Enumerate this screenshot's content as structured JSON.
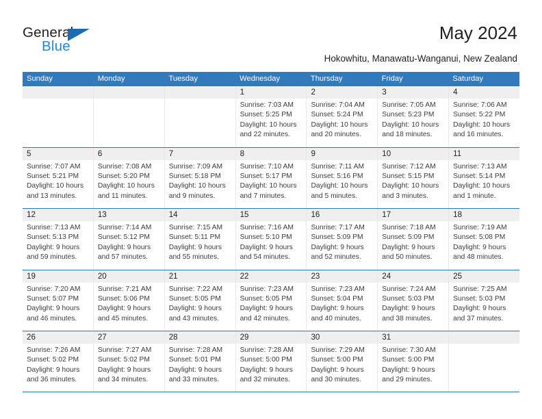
{
  "brand": {
    "name_top": "General",
    "name_bottom": "Blue",
    "triangle_color": "#1b6cb3",
    "blue_text_color": "#2487d4"
  },
  "header": {
    "title": "May 2024",
    "subtitle": "Hokowhitu, Manawatu-Wanganui, New Zealand"
  },
  "theme": {
    "header_row_bg": "#3379bd",
    "row_divider": "#2f76bb",
    "day_number_bg": "#efefef"
  },
  "weekdays": [
    "Sunday",
    "Monday",
    "Tuesday",
    "Wednesday",
    "Thursday",
    "Friday",
    "Saturday"
  ],
  "weeks": [
    [
      {
        "day": "",
        "sunrise": "",
        "sunset": "",
        "daylight": "",
        "empty": true
      },
      {
        "day": "",
        "sunrise": "",
        "sunset": "",
        "daylight": "",
        "empty": true
      },
      {
        "day": "",
        "sunrise": "",
        "sunset": "",
        "daylight": "",
        "empty": true
      },
      {
        "day": "1",
        "sunrise": "Sunrise: 7:03 AM",
        "sunset": "Sunset: 5:25 PM",
        "daylight": "Daylight: 10 hours and 22 minutes."
      },
      {
        "day": "2",
        "sunrise": "Sunrise: 7:04 AM",
        "sunset": "Sunset: 5:24 PM",
        "daylight": "Daylight: 10 hours and 20 minutes."
      },
      {
        "day": "3",
        "sunrise": "Sunrise: 7:05 AM",
        "sunset": "Sunset: 5:23 PM",
        "daylight": "Daylight: 10 hours and 18 minutes."
      },
      {
        "day": "4",
        "sunrise": "Sunrise: 7:06 AM",
        "sunset": "Sunset: 5:22 PM",
        "daylight": "Daylight: 10 hours and 16 minutes."
      }
    ],
    [
      {
        "day": "5",
        "sunrise": "Sunrise: 7:07 AM",
        "sunset": "Sunset: 5:21 PM",
        "daylight": "Daylight: 10 hours and 13 minutes."
      },
      {
        "day": "6",
        "sunrise": "Sunrise: 7:08 AM",
        "sunset": "Sunset: 5:20 PM",
        "daylight": "Daylight: 10 hours and 11 minutes."
      },
      {
        "day": "7",
        "sunrise": "Sunrise: 7:09 AM",
        "sunset": "Sunset: 5:18 PM",
        "daylight": "Daylight: 10 hours and 9 minutes."
      },
      {
        "day": "8",
        "sunrise": "Sunrise: 7:10 AM",
        "sunset": "Sunset: 5:17 PM",
        "daylight": "Daylight: 10 hours and 7 minutes."
      },
      {
        "day": "9",
        "sunrise": "Sunrise: 7:11 AM",
        "sunset": "Sunset: 5:16 PM",
        "daylight": "Daylight: 10 hours and 5 minutes."
      },
      {
        "day": "10",
        "sunrise": "Sunrise: 7:12 AM",
        "sunset": "Sunset: 5:15 PM",
        "daylight": "Daylight: 10 hours and 3 minutes."
      },
      {
        "day": "11",
        "sunrise": "Sunrise: 7:13 AM",
        "sunset": "Sunset: 5:14 PM",
        "daylight": "Daylight: 10 hours and 1 minute."
      }
    ],
    [
      {
        "day": "12",
        "sunrise": "Sunrise: 7:13 AM",
        "sunset": "Sunset: 5:13 PM",
        "daylight": "Daylight: 9 hours and 59 minutes."
      },
      {
        "day": "13",
        "sunrise": "Sunrise: 7:14 AM",
        "sunset": "Sunset: 5:12 PM",
        "daylight": "Daylight: 9 hours and 57 minutes."
      },
      {
        "day": "14",
        "sunrise": "Sunrise: 7:15 AM",
        "sunset": "Sunset: 5:11 PM",
        "daylight": "Daylight: 9 hours and 55 minutes."
      },
      {
        "day": "15",
        "sunrise": "Sunrise: 7:16 AM",
        "sunset": "Sunset: 5:10 PM",
        "daylight": "Daylight: 9 hours and 54 minutes."
      },
      {
        "day": "16",
        "sunrise": "Sunrise: 7:17 AM",
        "sunset": "Sunset: 5:09 PM",
        "daylight": "Daylight: 9 hours and 52 minutes."
      },
      {
        "day": "17",
        "sunrise": "Sunrise: 7:18 AM",
        "sunset": "Sunset: 5:09 PM",
        "daylight": "Daylight: 9 hours and 50 minutes."
      },
      {
        "day": "18",
        "sunrise": "Sunrise: 7:19 AM",
        "sunset": "Sunset: 5:08 PM",
        "daylight": "Daylight: 9 hours and 48 minutes."
      }
    ],
    [
      {
        "day": "19",
        "sunrise": "Sunrise: 7:20 AM",
        "sunset": "Sunset: 5:07 PM",
        "daylight": "Daylight: 9 hours and 46 minutes."
      },
      {
        "day": "20",
        "sunrise": "Sunrise: 7:21 AM",
        "sunset": "Sunset: 5:06 PM",
        "daylight": "Daylight: 9 hours and 45 minutes."
      },
      {
        "day": "21",
        "sunrise": "Sunrise: 7:22 AM",
        "sunset": "Sunset: 5:05 PM",
        "daylight": "Daylight: 9 hours and 43 minutes."
      },
      {
        "day": "22",
        "sunrise": "Sunrise: 7:23 AM",
        "sunset": "Sunset: 5:05 PM",
        "daylight": "Daylight: 9 hours and 42 minutes."
      },
      {
        "day": "23",
        "sunrise": "Sunrise: 7:23 AM",
        "sunset": "Sunset: 5:04 PM",
        "daylight": "Daylight: 9 hours and 40 minutes."
      },
      {
        "day": "24",
        "sunrise": "Sunrise: 7:24 AM",
        "sunset": "Sunset: 5:03 PM",
        "daylight": "Daylight: 9 hours and 38 minutes."
      },
      {
        "day": "25",
        "sunrise": "Sunrise: 7:25 AM",
        "sunset": "Sunset: 5:03 PM",
        "daylight": "Daylight: 9 hours and 37 minutes."
      }
    ],
    [
      {
        "day": "26",
        "sunrise": "Sunrise: 7:26 AM",
        "sunset": "Sunset: 5:02 PM",
        "daylight": "Daylight: 9 hours and 36 minutes."
      },
      {
        "day": "27",
        "sunrise": "Sunrise: 7:27 AM",
        "sunset": "Sunset: 5:02 PM",
        "daylight": "Daylight: 9 hours and 34 minutes."
      },
      {
        "day": "28",
        "sunrise": "Sunrise: 7:28 AM",
        "sunset": "Sunset: 5:01 PM",
        "daylight": "Daylight: 9 hours and 33 minutes."
      },
      {
        "day": "29",
        "sunrise": "Sunrise: 7:28 AM",
        "sunset": "Sunset: 5:00 PM",
        "daylight": "Daylight: 9 hours and 32 minutes."
      },
      {
        "day": "30",
        "sunrise": "Sunrise: 7:29 AM",
        "sunset": "Sunset: 5:00 PM",
        "daylight": "Daylight: 9 hours and 30 minutes."
      },
      {
        "day": "31",
        "sunrise": "Sunrise: 7:30 AM",
        "sunset": "Sunset: 5:00 PM",
        "daylight": "Daylight: 9 hours and 29 minutes."
      },
      {
        "day": "",
        "sunrise": "",
        "sunset": "",
        "daylight": "",
        "empty": true
      }
    ]
  ]
}
